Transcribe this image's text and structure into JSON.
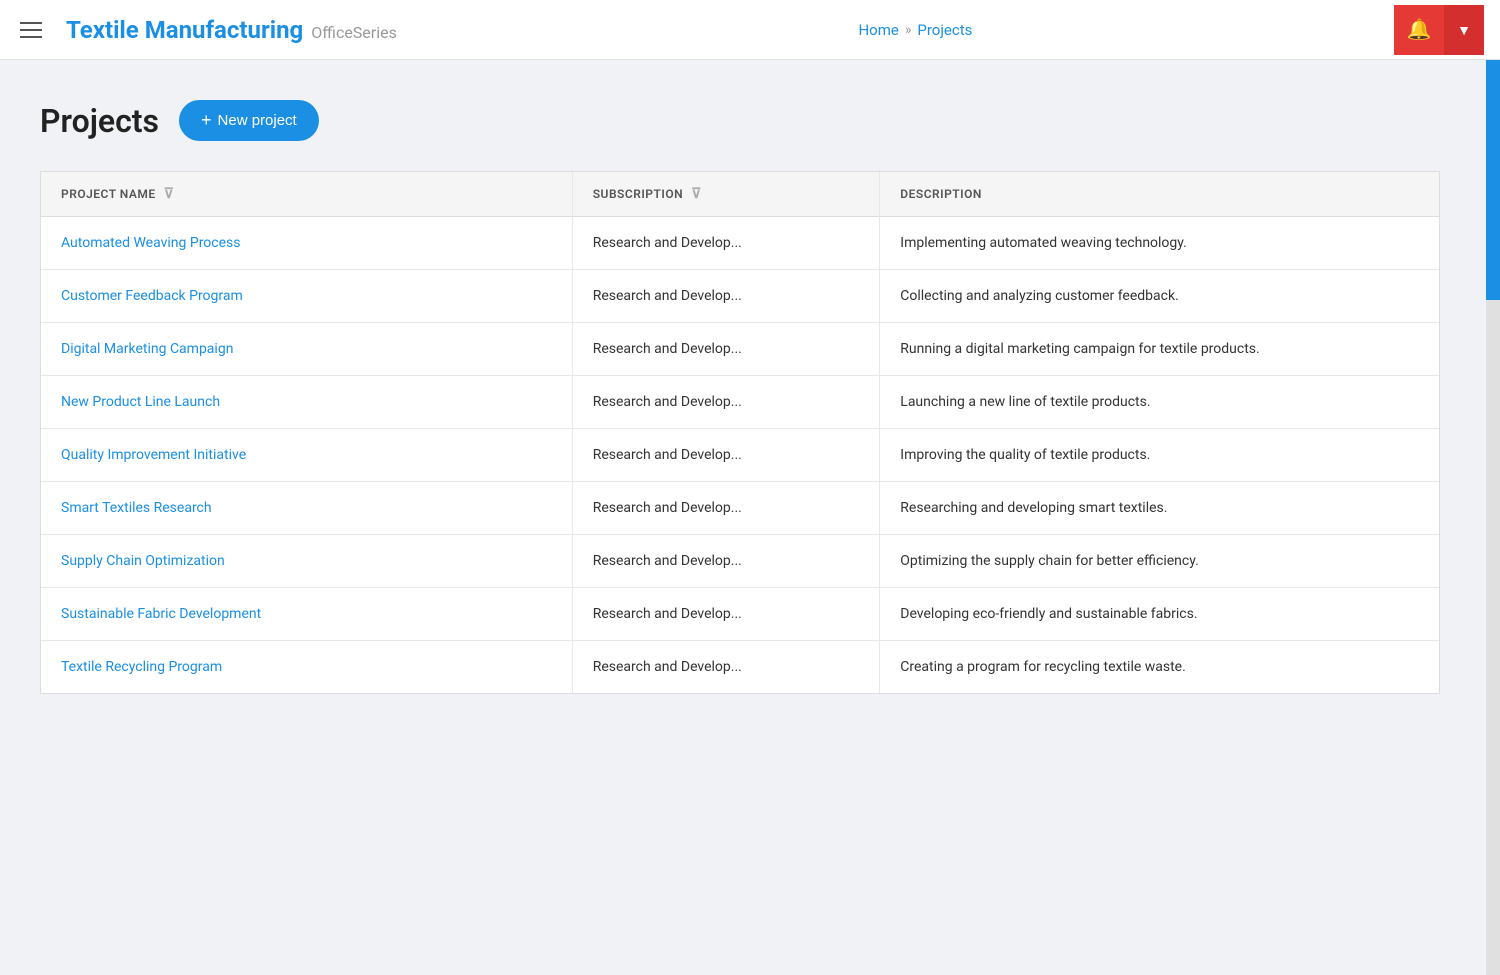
{
  "header": {
    "menu_label": "Menu",
    "brand_title": "Textile Manufacturing",
    "brand_subtitle": "OfficeSeries",
    "nav_home": "Home",
    "nav_separator": "»",
    "nav_projects": "Projects"
  },
  "page": {
    "title": "Projects",
    "new_project_label": "+ New project"
  },
  "table": {
    "columns": [
      {
        "key": "project_name",
        "label": "PROJECT NAME"
      },
      {
        "key": "subscription",
        "label": "SUBSCRIPTION"
      },
      {
        "key": "description",
        "label": "DESCRIPTION"
      }
    ],
    "rows": [
      {
        "project_name": "Automated Weaving Process",
        "subscription": "Research and Develop...",
        "description": "Implementing automated weaving technology."
      },
      {
        "project_name": "Customer Feedback Program",
        "subscription": "Research and Develop...",
        "description": "Collecting and analyzing customer feedback."
      },
      {
        "project_name": "Digital Marketing Campaign",
        "subscription": "Research and Develop...",
        "description": "Running a digital marketing campaign for textile products."
      },
      {
        "project_name": "New Product Line Launch",
        "subscription": "Research and Develop...",
        "description": "Launching a new line of textile products."
      },
      {
        "project_name": "Quality Improvement Initiative",
        "subscription": "Research and Develop...",
        "description": "Improving the quality of textile products."
      },
      {
        "project_name": "Smart Textiles Research",
        "subscription": "Research and Develop...",
        "description": "Researching and developing smart textiles."
      },
      {
        "project_name": "Supply Chain Optimization",
        "subscription": "Research and Develop...",
        "description": "Optimizing the supply chain for better efficiency."
      },
      {
        "project_name": "Sustainable Fabric Development",
        "subscription": "Research and Develop...",
        "description": "Developing eco-friendly and sustainable fabrics."
      },
      {
        "project_name": "Textile Recycling Program",
        "subscription": "Research and Develop...",
        "description": "Creating a program for recycling textile waste."
      }
    ]
  },
  "colors": {
    "brand_blue": "#1a8fe3",
    "accent_red": "#e53935",
    "accent_dark_red": "#d32f2f"
  }
}
